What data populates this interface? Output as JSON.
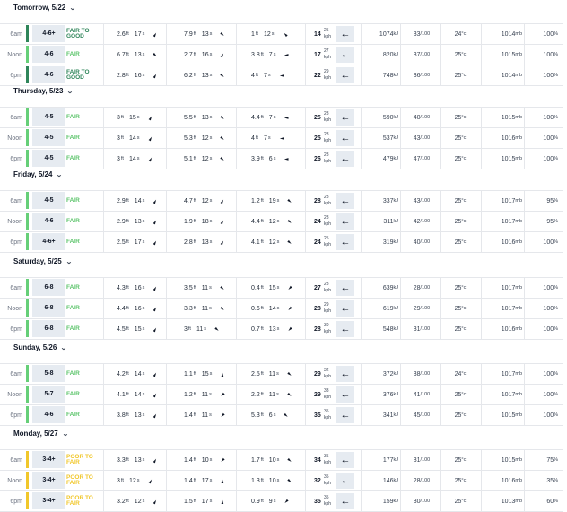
{
  "colors": {
    "good": "#2f855a",
    "fair": "#5cc46b",
    "poor": "#f1c72b",
    "good_bar": "#2f855a",
    "fair_bar": "#66cf78",
    "poor_bar": "#f1c72b"
  },
  "days": [
    {
      "label": "Tomorrow, 5/22",
      "rows": [
        {
          "time": "6am",
          "size": "4-6+",
          "rating": "FAIR TO GOOD",
          "level": "good",
          "s1h": "2.6",
          "s1p": "17",
          "s1a": "northeast",
          "s2h": "7.9",
          "s2p": "13",
          "s2a": "southeast",
          "s3h": "1",
          "s3p": "12",
          "s3a": "northwest",
          "wsp": "14",
          "wgust": "25",
          "warrow": "←",
          "energy": "1074",
          "humidity": "33",
          "temp": "24",
          "pressure": "1014",
          "cloud": "100"
        },
        {
          "time": "Noon",
          "size": "4-6",
          "rating": "FAIR",
          "level": "fair",
          "s1h": "6.7",
          "s1p": "13",
          "s1a": "southeast",
          "s2h": "2.7",
          "s2p": "16",
          "s2a": "northeast",
          "s3h": "3.8",
          "s3p": "7",
          "s3a": "west",
          "wsp": "17",
          "wgust": "27",
          "warrow": "←",
          "energy": "820",
          "humidity": "37",
          "temp": "25",
          "pressure": "1015",
          "cloud": "100"
        },
        {
          "time": "6pm",
          "size": "4-6",
          "rating": "FAIR TO GOOD",
          "level": "good",
          "s1h": "2.8",
          "s1p": "16",
          "s1a": "northeast",
          "s2h": "6.2",
          "s2p": "13",
          "s2a": "southeast",
          "s3h": "4",
          "s3p": "7",
          "s3a": "west",
          "wsp": "22",
          "wgust": "29",
          "warrow": "←",
          "energy": "748",
          "humidity": "36",
          "temp": "25",
          "pressure": "1014",
          "cloud": "100"
        }
      ]
    },
    {
      "label": "Thursday, 5/23",
      "rows": [
        {
          "time": "6am",
          "size": "4-5",
          "rating": "FAIR",
          "level": "fair",
          "s1h": "3",
          "s1p": "15",
          "s1a": "northeast",
          "s2h": "5.5",
          "s2p": "13",
          "s2a": "southeast",
          "s3h": "4.4",
          "s3p": "7",
          "s3a": "west",
          "wsp": "25",
          "wgust": "28",
          "warrow": "←",
          "energy": "590",
          "humidity": "40",
          "temp": "25",
          "pressure": "1015",
          "cloud": "100"
        },
        {
          "time": "Noon",
          "size": "4-5",
          "rating": "FAIR",
          "level": "fair",
          "s1h": "3",
          "s1p": "14",
          "s1a": "northeast",
          "s2h": "5.3",
          "s2p": "12",
          "s2a": "southeast",
          "s3h": "4",
          "s3p": "7",
          "s3a": "west",
          "wsp": "25",
          "wgust": "28",
          "warrow": "←",
          "energy": "537",
          "humidity": "43",
          "temp": "25",
          "pressure": "1016",
          "cloud": "100"
        },
        {
          "time": "6pm",
          "size": "4-5",
          "rating": "FAIR",
          "level": "fair",
          "s1h": "3",
          "s1p": "14",
          "s1a": "northeast",
          "s2h": "5.1",
          "s2p": "12",
          "s2a": "southeast",
          "s3h": "3.9",
          "s3p": "6",
          "s3a": "west",
          "wsp": "26",
          "wgust": "28",
          "warrow": "←",
          "energy": "479",
          "humidity": "47",
          "temp": "25",
          "pressure": "1015",
          "cloud": "100"
        }
      ]
    },
    {
      "label": "Friday, 5/24",
      "rows": [
        {
          "time": "6am",
          "size": "4-5",
          "rating": "FAIR",
          "level": "fair",
          "s1h": "2.9",
          "s1p": "14",
          "s1a": "northeast",
          "s2h": "4.7",
          "s2p": "12",
          "s2a": "northeast",
          "s3h": "1.2",
          "s3p": "19",
          "s3a": "southeast",
          "wsp": "28",
          "wgust": "28",
          "warrow": "←",
          "energy": "337",
          "humidity": "43",
          "temp": "25",
          "pressure": "1017",
          "cloud": "95"
        },
        {
          "time": "Noon",
          "size": "4-6",
          "rating": "FAIR",
          "level": "fair",
          "s1h": "2.9",
          "s1p": "13",
          "s1a": "northeast",
          "s2h": "1.9",
          "s2p": "18",
          "s2a": "northeast",
          "s3h": "4.4",
          "s3p": "12",
          "s3a": "southeast",
          "wsp": "24",
          "wgust": "28",
          "warrow": "←",
          "energy": "311",
          "humidity": "42",
          "temp": "25",
          "pressure": "1017",
          "cloud": "95"
        },
        {
          "time": "6pm",
          "size": "4-6+",
          "rating": "FAIR",
          "level": "fair",
          "s1h": "2.5",
          "s1p": "17",
          "s1a": "northeast",
          "s2h": "2.8",
          "s2p": "13",
          "s2a": "northeast",
          "s3h": "4.1",
          "s3p": "12",
          "s3a": "southeast",
          "wsp": "24",
          "wgust": "25",
          "warrow": "←",
          "energy": "319",
          "humidity": "40",
          "temp": "25",
          "pressure": "1016",
          "cloud": "100"
        }
      ]
    },
    {
      "label": "Saturday, 5/25",
      "rows": [
        {
          "time": "6am",
          "size": "6-8",
          "rating": "FAIR",
          "level": "fair",
          "s1h": "4.3",
          "s1p": "16",
          "s1a": "northeast",
          "s2h": "3.5",
          "s2p": "11",
          "s2a": "southeast",
          "s3h": "0.4",
          "s3p": "15",
          "s3a": "southwest",
          "wsp": "27",
          "wgust": "28",
          "warrow": "←",
          "energy": "639",
          "humidity": "28",
          "temp": "25",
          "pressure": "1017",
          "cloud": "100"
        },
        {
          "time": "Noon",
          "size": "6-8",
          "rating": "FAIR",
          "level": "fair",
          "s1h": "4.4",
          "s1p": "16",
          "s1a": "northeast",
          "s2h": "3.3",
          "s2p": "11",
          "s2a": "southeast",
          "s3h": "0.6",
          "s3p": "14",
          "s3a": "southwest",
          "wsp": "28",
          "wgust": "29",
          "warrow": "←",
          "energy": "619",
          "humidity": "29",
          "temp": "25",
          "pressure": "1017",
          "cloud": "100"
        },
        {
          "time": "6pm",
          "size": "6-8",
          "rating": "FAIR",
          "level": "fair",
          "s1h": "4.5",
          "s1p": "15",
          "s1a": "northeast",
          "s2h": "3",
          "s2p": "11",
          "s2a": "southeast",
          "s3h": "0.7",
          "s3p": "13",
          "s3a": "southwest",
          "wsp": "28",
          "wgust": "30",
          "warrow": "←",
          "energy": "548",
          "humidity": "31",
          "temp": "25",
          "pressure": "1016",
          "cloud": "100"
        }
      ]
    },
    {
      "label": "Sunday, 5/26",
      "rows": [
        {
          "time": "6am",
          "size": "5-8",
          "rating": "FAIR",
          "level": "fair",
          "s1h": "4.2",
          "s1p": "14",
          "s1a": "northeast",
          "s2h": "1.1",
          "s2p": "15",
          "s2a": "north",
          "s3h": "2.5",
          "s3p": "11",
          "s3a": "southeast",
          "wsp": "29",
          "wgust": "32",
          "warrow": "←",
          "energy": "372",
          "humidity": "38",
          "temp": "24",
          "pressure": "1017",
          "cloud": "100"
        },
        {
          "time": "Noon",
          "size": "5-7",
          "rating": "FAIR",
          "level": "fair",
          "s1h": "4.1",
          "s1p": "14",
          "s1a": "northeast",
          "s2h": "1.2",
          "s2p": "11",
          "s2a": "southwest",
          "s3h": "2.2",
          "s3p": "11",
          "s3a": "southeast",
          "wsp": "29",
          "wgust": "33",
          "warrow": "←",
          "energy": "376",
          "humidity": "41",
          "temp": "25",
          "pressure": "1017",
          "cloud": "100"
        },
        {
          "time": "6pm",
          "size": "4-6",
          "rating": "FAIR",
          "level": "fair",
          "s1h": "3.8",
          "s1p": "13",
          "s1a": "northeast",
          "s2h": "1.4",
          "s2p": "11",
          "s2a": "southwest",
          "s3h": "5.3",
          "s3p": "6",
          "s3a": "southeast",
          "wsp": "35",
          "wgust": "35",
          "warrow": "←",
          "energy": "341",
          "humidity": "45",
          "temp": "25",
          "pressure": "1015",
          "cloud": "100"
        }
      ]
    },
    {
      "label": "Monday, 5/27",
      "rows": [
        {
          "time": "6am",
          "size": "3-4+",
          "rating": "POOR TO FAIR",
          "level": "poor",
          "s1h": "3.3",
          "s1p": "13",
          "s1a": "northeast",
          "s2h": "1.4",
          "s2p": "10",
          "s2a": "southwest",
          "s3h": "1.7",
          "s3p": "10",
          "s3a": "southeast",
          "wsp": "34",
          "wgust": "35",
          "warrow": "←",
          "energy": "177",
          "humidity": "31",
          "temp": "25",
          "pressure": "1015",
          "cloud": "75"
        },
        {
          "time": "Noon",
          "size": "3-4+",
          "rating": "POOR TO FAIR",
          "level": "poor",
          "s1h": "3",
          "s1p": "12",
          "s1a": "northeast",
          "s2h": "1.4",
          "s2p": "17",
          "s2a": "north",
          "s3h": "1.3",
          "s3p": "10",
          "s3a": "southeast",
          "wsp": "32",
          "wgust": "35",
          "warrow": "←",
          "energy": "146",
          "humidity": "28",
          "temp": "25",
          "pressure": "1016",
          "cloud": "35"
        },
        {
          "time": "6pm",
          "size": "3-4+",
          "rating": "POOR TO FAIR",
          "level": "poor",
          "s1h": "3.2",
          "s1p": "12",
          "s1a": "northeast",
          "s2h": "1.5",
          "s2p": "17",
          "s2a": "north",
          "s3h": "0.9",
          "s3p": "9",
          "s3a": "southwest",
          "wsp": "35",
          "wgust": "35",
          "warrow": "←",
          "energy": "159",
          "humidity": "30",
          "temp": "25",
          "pressure": "1013",
          "cloud": "60"
        }
      ]
    }
  ],
  "units": {
    "ft": "ft",
    "s": "s",
    "kph": "kph",
    "kj": "kJ",
    "humidity": "/100",
    "temp": "°c",
    "pressure": "mb",
    "cloud": "%"
  }
}
